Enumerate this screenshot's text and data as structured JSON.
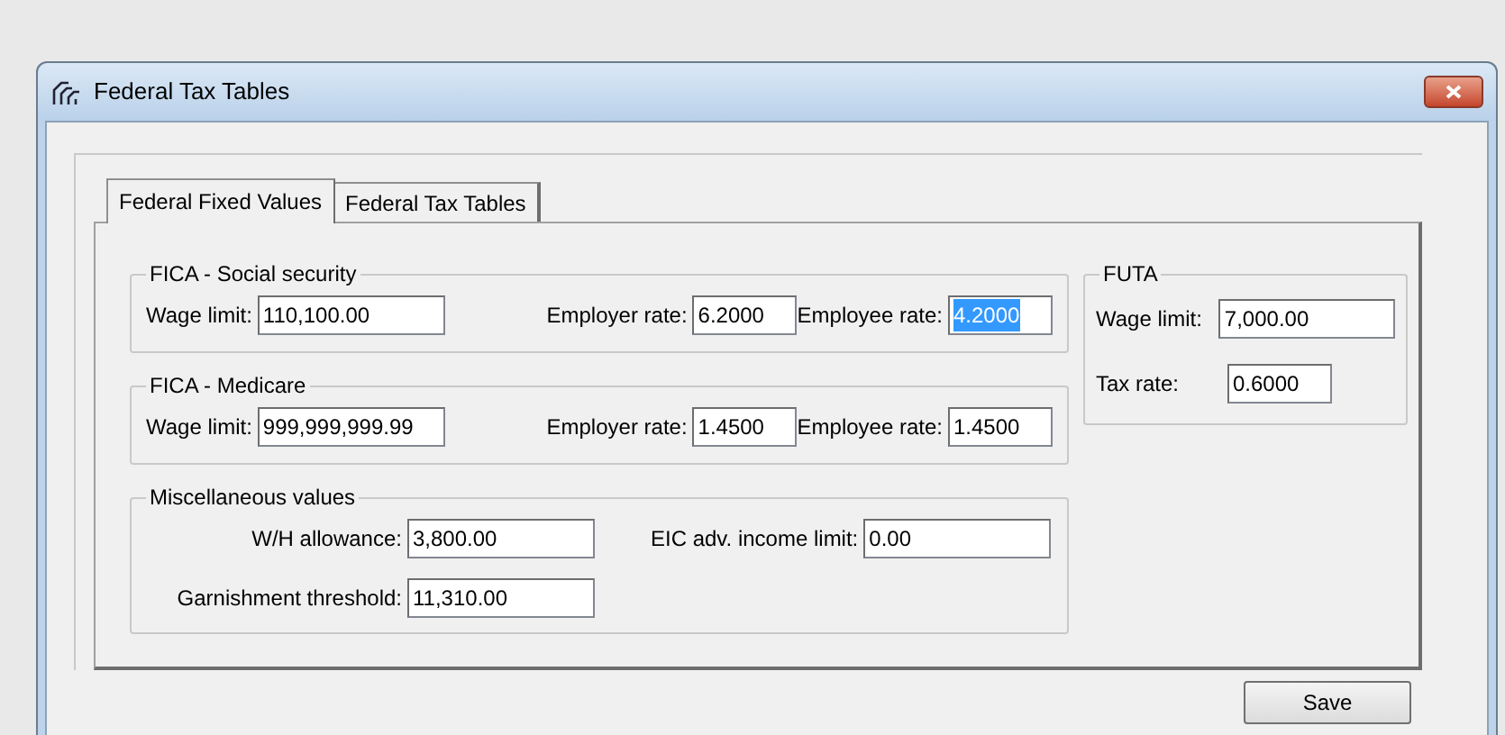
{
  "window": {
    "title": "Federal Tax Tables"
  },
  "tabs": [
    {
      "label": "Federal Fixed Values",
      "selected": true
    },
    {
      "label": "Federal Tax Tables",
      "selected": false
    }
  ],
  "groups": [
    {
      "title": "FICA - Social security",
      "rows": [
        [
          {
            "label": "Wage limit:",
            "value": "110,100.00",
            "kind": "amount",
            "text_selected": false
          },
          {
            "label": "Employer rate:",
            "value": "6.2000",
            "kind": "rate",
            "text_selected": false
          },
          {
            "label": "Employee rate:",
            "value": "4.2000",
            "kind": "rate",
            "text_selected": true
          }
        ]
      ]
    },
    {
      "title": "FICA - Medicare",
      "rows": [
        [
          {
            "label": "Wage limit:",
            "value": "999,999,999.99",
            "kind": "amount",
            "text_selected": false
          },
          {
            "label": "Employer rate:",
            "value": "1.4500",
            "kind": "rate",
            "text_selected": false
          },
          {
            "label": "Employee rate:",
            "value": "1.4500",
            "kind": "rate",
            "text_selected": false
          }
        ]
      ]
    },
    {
      "title": "Miscellaneous values",
      "rows": [
        [
          {
            "label": "W/H allowance:",
            "value": "3,800.00",
            "kind": "amount",
            "text_selected": false
          },
          {
            "label": "EIC adv. income limit:",
            "value": "0.00",
            "kind": "amount",
            "text_selected": false
          }
        ],
        [
          {
            "label": "Garnishment threshold:",
            "value": "11,310.00",
            "kind": "amount",
            "text_selected": false
          }
        ]
      ]
    }
  ],
  "futa": {
    "title": "FUTA",
    "fields": [
      {
        "label": "Wage limit:",
        "value": "7,000.00",
        "kind": "amount",
        "text_selected": false
      },
      {
        "label": "Tax rate:",
        "value": "0.6000",
        "kind": "rate",
        "text_selected": false
      }
    ]
  },
  "save_button": {
    "label": "Save"
  }
}
